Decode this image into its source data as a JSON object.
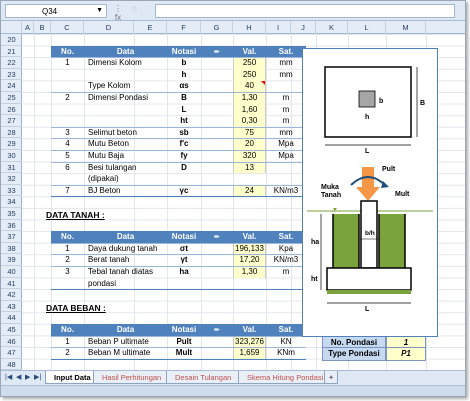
{
  "formula_bar": {
    "name_box": "Q34",
    "fx": "fx",
    "formula": ""
  },
  "columns": [
    "A",
    "B",
    "C",
    "D",
    "E",
    "F",
    "G",
    "H",
    "I",
    "J",
    "K",
    "L",
    "M"
  ],
  "rows": [
    "20",
    "21",
    "22",
    "23",
    "24",
    "25",
    "26",
    "27",
    "28",
    "29",
    "30",
    "31",
    "32",
    "33",
    "34",
    "35",
    "36",
    "37",
    "38",
    "39",
    "40",
    "41",
    "42",
    "43",
    "44",
    "45",
    "46",
    "47",
    "48"
  ],
  "table_header": {
    "no": "No.",
    "data": "Data",
    "notasi": "Notasi",
    "val": "Val.",
    "sat": "Sat."
  },
  "main_rows": [
    {
      "no": "1",
      "data": "Dimensi Kolom",
      "notasi": "b",
      "val": "250",
      "sat": "mm"
    },
    {
      "no": "",
      "data": "",
      "notasi": "h",
      "val": "250",
      "sat": "mm"
    },
    {
      "no": "",
      "data": "Type Kolom",
      "notasi": "αs",
      "val": "40",
      "sat": ""
    },
    {
      "no": "2",
      "data": "Dimensi Pondasi",
      "notasi": "B",
      "val": "1,30",
      "sat": "m"
    },
    {
      "no": "",
      "data": "",
      "notasi": "L",
      "val": "1,60",
      "sat": "m"
    },
    {
      "no": "",
      "data": "",
      "notasi": "ht",
      "val": "0,30",
      "sat": "m"
    },
    {
      "no": "3",
      "data": "Selimut beton",
      "notasi": "sb",
      "val": "75",
      "sat": "mm"
    },
    {
      "no": "4",
      "data": "Mutu Beton",
      "notasi": "f'c",
      "val": "20",
      "sat": "Mpa"
    },
    {
      "no": "5",
      "data": "Mutu Baja",
      "notasi": "fy",
      "val": "320",
      "sat": "Mpa"
    },
    {
      "no": "6",
      "data": "Besi tulangan",
      "notasi": "D",
      "val": "13",
      "sat": ""
    },
    {
      "no": "",
      "data": "(dipakai)",
      "notasi": "",
      "val": "",
      "sat": ""
    },
    {
      "no": "7",
      "data": "BJ Beton",
      "notasi": "γc",
      "val": "24",
      "sat": "KN/m3"
    }
  ],
  "tanah": {
    "title": "DATA TANAH :",
    "rows": [
      {
        "no": "1",
        "data": "Daya dukung tanah",
        "notasi": "σt",
        "val": "196,133",
        "sat": "Kpa"
      },
      {
        "no": "2",
        "data": "Berat tanah",
        "notasi": "γt",
        "val": "17,20",
        "sat": "KN/m3"
      },
      {
        "no": "3",
        "data": "Tebal tanah diatas",
        "notasi": "ha",
        "val": "1,30",
        "sat": "m"
      },
      {
        "no": "",
        "data": "pondasi",
        "notasi": "",
        "val": "",
        "sat": ""
      }
    ]
  },
  "beban": {
    "title": "DATA BEBAN :",
    "rows": [
      {
        "no": "1",
        "data": "Beban P ultimate",
        "notasi": "Pult",
        "val": "323,276",
        "sat": "KN"
      },
      {
        "no": "2",
        "data": "Beban M ultimate",
        "notasi": "Mult",
        "val": "1,659",
        "sat": "KNm"
      }
    ]
  },
  "pondasi_info": {
    "no_label": "No. Pondasi",
    "no_value": "1",
    "type_label": "Type Pondasi",
    "type_value": "P1"
  },
  "diagram": {
    "b": "b",
    "h": "h",
    "B": "B",
    "L": "L",
    "pult": "Pult",
    "muka_tanah": "Muka\nTanah",
    "mult": "Mult",
    "ha": "ha",
    "bh": "b/h",
    "ht": "ht",
    "L2": "L"
  },
  "sheets": [
    "Input Data",
    "Hasil Perhitungan",
    "Desain Tulangan",
    "Skema Hitung Pondasi"
  ],
  "colors": {
    "header": "#4f81bd",
    "input": "#ffffcc",
    "soil": "#7aa23d"
  }
}
